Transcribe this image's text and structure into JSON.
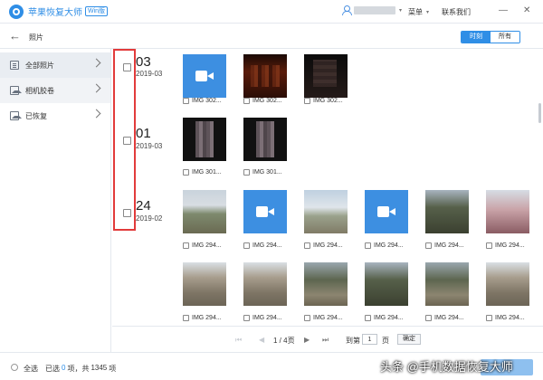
{
  "titlebar": {
    "app_name": "苹果恢复大师",
    "edition": "Win版",
    "menu_label": "菜单",
    "contact_label": "联系我们",
    "caret": "▾",
    "minimize": "—",
    "close": "✕"
  },
  "navbar": {
    "back": "←",
    "title": "照片",
    "view_time": "时刻",
    "view_all": "所有"
  },
  "sidebar": {
    "items": [
      {
        "label": "全部照片",
        "icon": "photo-icon"
      },
      {
        "label": "相机胶卷",
        "icon": "camera-roll-icon"
      },
      {
        "label": "已恢复",
        "icon": "recovered-icon"
      }
    ]
  },
  "groups": [
    {
      "day": "03",
      "month": "2019-03"
    },
    {
      "day": "01",
      "month": "2019-03"
    },
    {
      "day": "24",
      "month": "2019-02"
    }
  ],
  "photos": {
    "g1": [
      "IMG 302...",
      "IMG 302...",
      "IMG 302..."
    ],
    "g2": [
      "IMG 301...",
      "IMG 301..."
    ],
    "g3": [
      "IMG 294...",
      "IMG 294...",
      "IMG 294...",
      "IMG 294...",
      "IMG 294...",
      "IMG 294...",
      "IMG 294...",
      "IMG 294...",
      "IMG 294...",
      "IMG 294...",
      "IMG 294...",
      "IMG 294..."
    ]
  },
  "pager": {
    "first": "⏮",
    "prev": "◀",
    "page_info": "1 / 4页",
    "next": "▶",
    "last": "⏭",
    "goto_label": "到第",
    "page_input": "1",
    "page_unit": "页",
    "confirm": "确定"
  },
  "footer": {
    "select_all": "全选",
    "selected_prefix": "已选",
    "selected_count": "0",
    "selected_mid": "项，共",
    "total": "1345",
    "total_suffix": "项"
  },
  "watermark": "头条 @手机数据恢复大师"
}
